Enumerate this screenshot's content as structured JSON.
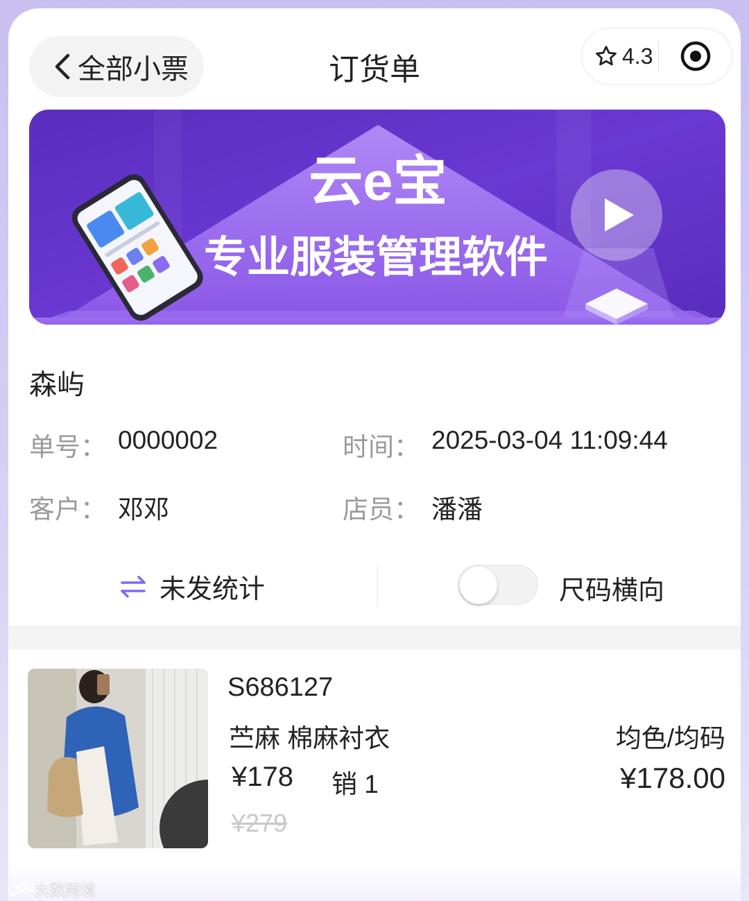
{
  "header": {
    "back_label": "全部小票",
    "title": "订货单",
    "rating": "4.3"
  },
  "banner": {
    "brand": "云e宝",
    "slogan": "专业服装管理软件",
    "colors": {
      "bg_start": "#5b2fbf",
      "bg_end": "#8a55e8",
      "accent": "#a97cf5"
    }
  },
  "order": {
    "store_name": "森屿",
    "number_label": "单号：",
    "number_value": "0000002",
    "time_label": "时间：",
    "time_value": "2025-03-04 11:09:44",
    "customer_label": "客户：",
    "customer_value": "邓邓",
    "clerk_label": "店员：",
    "clerk_value": "潘潘"
  },
  "controls": {
    "stat_label": "未发统计",
    "toggle_label": "尺码横向",
    "toggle_on": false,
    "accent_color": "#7b6cf0"
  },
  "product": {
    "sku": "S686127",
    "name": "苎麻 棉麻衬衣",
    "variant": "均色/均码",
    "price": "¥178",
    "sold": "销 1",
    "subtotal": "¥178.00",
    "original_price": "¥279"
  },
  "watermark": "大数跨境"
}
